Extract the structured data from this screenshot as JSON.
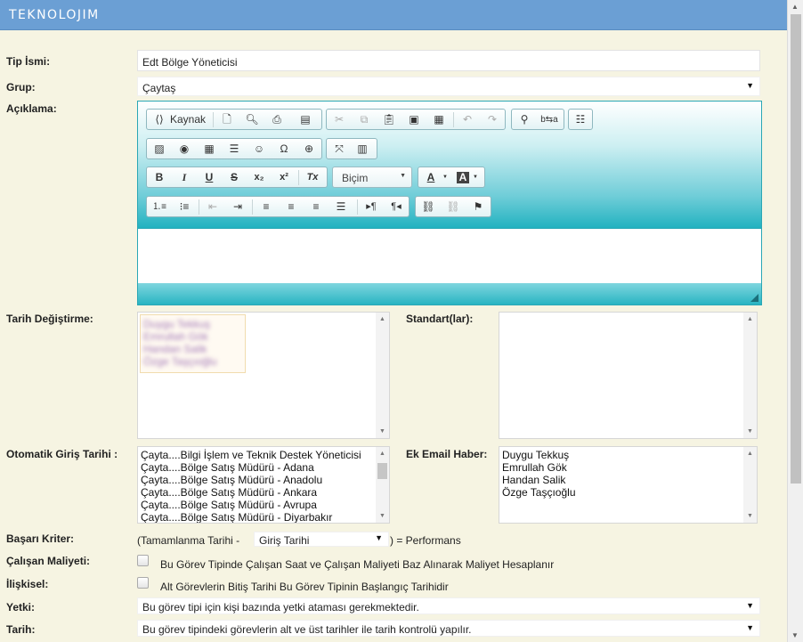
{
  "header": {
    "brand": "TEKNOLOJIM"
  },
  "form": {
    "tip_ismi": {
      "label": "Tip İsmi:",
      "value": "Edt Bölge Yöneticisi"
    },
    "grup": {
      "label": "Grup:",
      "value": "Çaytaş"
    },
    "aciklama": {
      "label": "Açıklama:"
    },
    "tarih_degistirme": {
      "label": "Tarih Değiştirme:",
      "items": [
        "Duygu Tekkuş",
        "Emrullah Gök",
        "Handan Salik",
        "Özge Taşçıoğlu"
      ]
    },
    "standartlar": {
      "label": "Standart(lar):"
    },
    "otomatik_giris": {
      "label": "Otomatik Giriş Tarihi :",
      "items": [
        "Çayta....Bilgi İşlem ve Teknik Destek Yöneticisi",
        "Çayta....Bölge Satış Müdürü - Adana",
        "Çayta....Bölge Satış Müdürü - Anadolu",
        "Çayta....Bölge Satış Müdürü - Ankara",
        "Çayta....Bölge Satış Müdürü - Avrupa",
        "Çayta....Bölge Satış Müdürü - Diyarbakır"
      ]
    },
    "ek_email": {
      "label": "Ek Email Haber:",
      "items": [
        "Duygu Tekkuş",
        "Emrullah Gök",
        "Handan Salik",
        "Özge Taşçıoğlu"
      ]
    },
    "basari": {
      "label": "Başarı Kriter:",
      "prefix": "(Tamamlanma Tarihi -",
      "select": "Giriş Tarihi",
      "suffix": ") = Performans"
    },
    "calisan": {
      "label": "Çalışan Maliyeti:",
      "text": "Bu Görev Tipinde Çalışan Saat ve Çalışan Maliyeti Baz Alınarak Maliyet Hesaplanır"
    },
    "iliskisel": {
      "label": "İlişkisel:",
      "text": "Alt Görevlerin Bitiş Tarihi Bu Görev Tipinin Başlangıç Tarihidir"
    },
    "yetki": {
      "label": "Yetki:",
      "value": "Bu görev tipi için kişi bazında yetki ataması gerekmektedir."
    },
    "tarih": {
      "label": "Tarih:",
      "value": "Bu görev tipindeki görevlerin alt ve üst tarihler ile tarih kontrolü yapılır."
    }
  },
  "editor": {
    "source_label": "Kaynak",
    "format_label": "Biçim",
    "text_color_label": "A",
    "bg_color_label": "A",
    "bold": "B",
    "italic": "I",
    "underline": "U",
    "strike": "S",
    "subscript": "x₂",
    "superscript": "x²",
    "remove_format": "Tx",
    "omega": "Ω"
  }
}
